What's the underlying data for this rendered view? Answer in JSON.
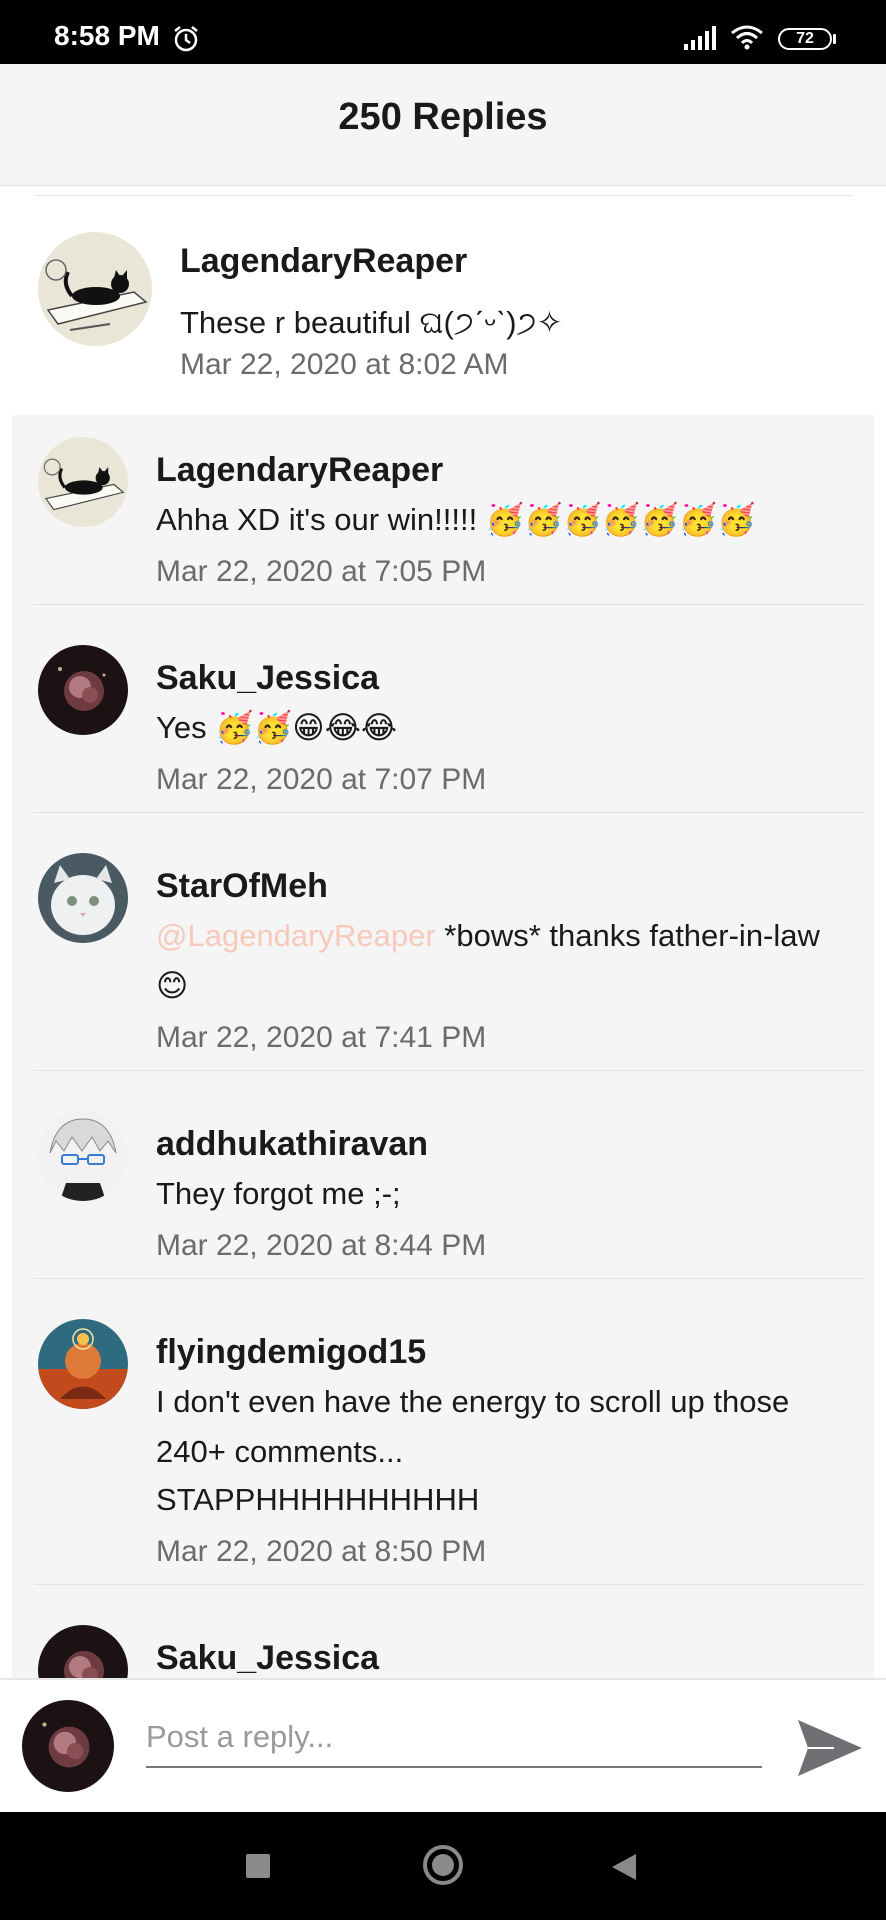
{
  "status_bar": {
    "time": "8:58 PM",
    "battery": "72",
    "icons": [
      "alarm-icon",
      "signal-icon",
      "wifi-icon",
      "battery-icon"
    ]
  },
  "header": {
    "title": "250 Replies"
  },
  "root_comment": {
    "user": "LagendaryReaper",
    "text": "These r beautiful ଘ(੭ˊᵕˋ)੭✧",
    "time": "Mar 22, 2020 at 8:02 AM"
  },
  "replies": [
    {
      "user": "LagendaryReaper",
      "text": "Ahha XD it's our win!!!!! 🥳🥳🥳🥳🥳🥳🥳",
      "time": "Mar 22, 2020 at 7:05 PM"
    },
    {
      "user": "Saku_Jessica",
      "text": "Yes 🥳🥳😁😂😂",
      "time": "Mar 22, 2020 at 7:07 PM"
    },
    {
      "user": "StarOfMeh",
      "mention": "@LagendaryReaper",
      "text": "*bows* thanks father-in-law",
      "text_line2": "😊",
      "time": "Mar 22, 2020 at 7:41 PM"
    },
    {
      "user": "addhukathiravan",
      "text": "They forgot me ;-;",
      "time": "Mar 22, 2020 at 8:44 PM"
    },
    {
      "user": "flyingdemigod15",
      "text": "I don't even have the energy to scroll up those",
      "text_line2": "240+ comments...",
      "text_line3": "STAPPHHHHHHHHHH",
      "time": "Mar 22, 2020 at 8:50 PM"
    },
    {
      "user": "Saku_Jessica"
    }
  ],
  "composer": {
    "placeholder": "Post a reply..."
  },
  "colors": {
    "mention": "#f7c9bb",
    "background": "#f5f5f5",
    "timestamp": "#6b6b6b"
  }
}
